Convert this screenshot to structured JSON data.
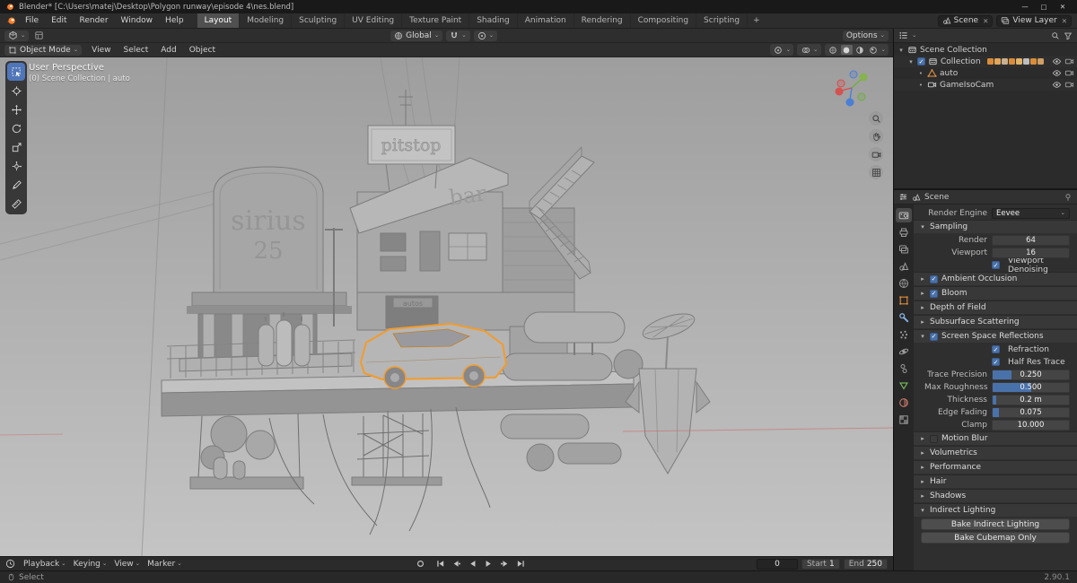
{
  "titlebar": {
    "title": "Blender* [C:\\Users\\matej\\Desktop\\Polygon runway\\episode 4\\nes.blend]",
    "window_controls": [
      {
        "name": "minimize",
        "glyph": "—"
      },
      {
        "name": "maximize",
        "glyph": "▢"
      },
      {
        "name": "close",
        "glyph": "✕"
      }
    ]
  },
  "topbar": {
    "menus": [
      "File",
      "Edit",
      "Render",
      "Window",
      "Help"
    ],
    "workspaces": [
      "Layout",
      "Modeling",
      "Sculpting",
      "UV Editing",
      "Texture Paint",
      "Shading",
      "Animation",
      "Rendering",
      "Compositing",
      "Scripting"
    ],
    "active_workspace": "Layout",
    "add_workspace_label": "+",
    "scene_label": "Scene",
    "view_layer_label": "View Layer"
  },
  "tool_header": {
    "orientation": "Global",
    "options_label": "Options"
  },
  "viewport_header": {
    "mode": "Object Mode",
    "menus": [
      "View",
      "Select",
      "Add",
      "Object"
    ]
  },
  "viewport": {
    "overlay_line1": "User Perspective",
    "overlay_line2": "(0) Scene Collection | auto",
    "scene_text": {
      "sign_big_1": "sirius",
      "sign_big_2": "25",
      "sign_top": "pitstop",
      "sign_bar": "bar",
      "sign_small": "autos"
    }
  },
  "tools": [
    {
      "name": "select-box",
      "active": true
    },
    {
      "name": "cursor"
    },
    {
      "name": "move"
    },
    {
      "name": "rotate"
    },
    {
      "name": "scale"
    },
    {
      "name": "transform"
    },
    {
      "name": "annotate"
    },
    {
      "name": "measure"
    }
  ],
  "outliner": {
    "rows": [
      {
        "label": "Scene Collection",
        "level": 0,
        "icon": "collection",
        "expand": true,
        "toggles": []
      },
      {
        "label": "Collection",
        "level": 1,
        "icon": "collection",
        "expand": true,
        "checked": true,
        "content_icons": [
          "#d98d3a",
          "#e2a75a",
          "#c9b08e",
          "#d98d3a",
          "#e0b468",
          "#bdbdbd",
          "#d98d3a",
          "#cf9f66"
        ],
        "toggles": [
          "eye",
          "camera"
        ]
      },
      {
        "label": "auto",
        "level": 2,
        "icon": "mesh",
        "toggles": [
          "eye",
          "camera"
        ]
      },
      {
        "label": "GameIsoCam",
        "level": 2,
        "icon": "camera",
        "toggles": [
          "eye",
          "camera"
        ]
      }
    ]
  },
  "properties": {
    "breadcrumb": "Scene",
    "render_engine_label": "Render Engine",
    "render_engine_value": "Eevee",
    "tabs": [
      {
        "name": "render",
        "active": true
      },
      {
        "name": "output"
      },
      {
        "name": "view-layer"
      },
      {
        "name": "scene"
      },
      {
        "name": "world"
      },
      {
        "name": "object"
      },
      {
        "name": "modifiers"
      },
      {
        "name": "particles"
      },
      {
        "name": "physics"
      },
      {
        "name": "constraints"
      },
      {
        "name": "data"
      },
      {
        "name": "material"
      },
      {
        "name": "texture"
      }
    ],
    "sections": [
      {
        "title": "Sampling",
        "expanded": true,
        "rows": [
          {
            "type": "value",
            "label": "Render",
            "value": "64"
          },
          {
            "type": "value",
            "label": "Viewport",
            "value": "16"
          },
          {
            "type": "check",
            "label": "Viewport Denoising",
            "checked": true
          }
        ]
      },
      {
        "title": "Ambient Occlusion",
        "checkbox": true,
        "checked": true
      },
      {
        "title": "Bloom",
        "checkbox": true,
        "checked": true
      },
      {
        "title": "Depth of Field"
      },
      {
        "title": "Subsurface Scattering"
      },
      {
        "title": "Screen Space Reflections",
        "checkbox": true,
        "checked": true,
        "expanded": true,
        "rows": [
          {
            "type": "check",
            "label": "Refraction",
            "checked": true
          },
          {
            "type": "check",
            "label": "Half Res Trace",
            "checked": true
          },
          {
            "type": "slider",
            "label": "Trace Precision",
            "value": "0.250",
            "fill": 25
          },
          {
            "type": "slider",
            "label": "Max Roughness",
            "value": "0.500",
            "fill": 50
          },
          {
            "type": "slider",
            "label": "Thickness",
            "value": "0.2 m",
            "fill": 5
          },
          {
            "type": "slider",
            "label": "Edge Fading",
            "value": "0.075",
            "fill": 8
          },
          {
            "type": "slider",
            "label": "Clamp",
            "value": "10.000",
            "fill": 0
          }
        ]
      },
      {
        "title": "Motion Blur",
        "checkbox": true,
        "checked": false
      },
      {
        "title": "Volumetrics"
      },
      {
        "title": "Performance"
      },
      {
        "title": "Hair"
      },
      {
        "title": "Shadows"
      },
      {
        "title": "Indirect Lighting",
        "expanded": true,
        "rows": [
          {
            "type": "button",
            "label": "Bake Indirect Lighting"
          },
          {
            "type": "button",
            "label": "Bake Cubemap Only"
          }
        ]
      }
    ]
  },
  "timeline": {
    "menus": [
      "Playback",
      "Keying",
      "View",
      "Marker"
    ],
    "transport": [
      "jump-start",
      "prev-keyframe",
      "play-reverse",
      "play-forward",
      "next-keyframe",
      "jump-end"
    ],
    "frame_current": "0",
    "start_label": "Start",
    "start_value": "1",
    "end_label": "End",
    "end_value": "250"
  },
  "statusbar": {
    "left": "Select",
    "version": "2.90.1"
  },
  "colors": {
    "accent": "#4a72aa",
    "selection_outline": "#f39b2b"
  }
}
